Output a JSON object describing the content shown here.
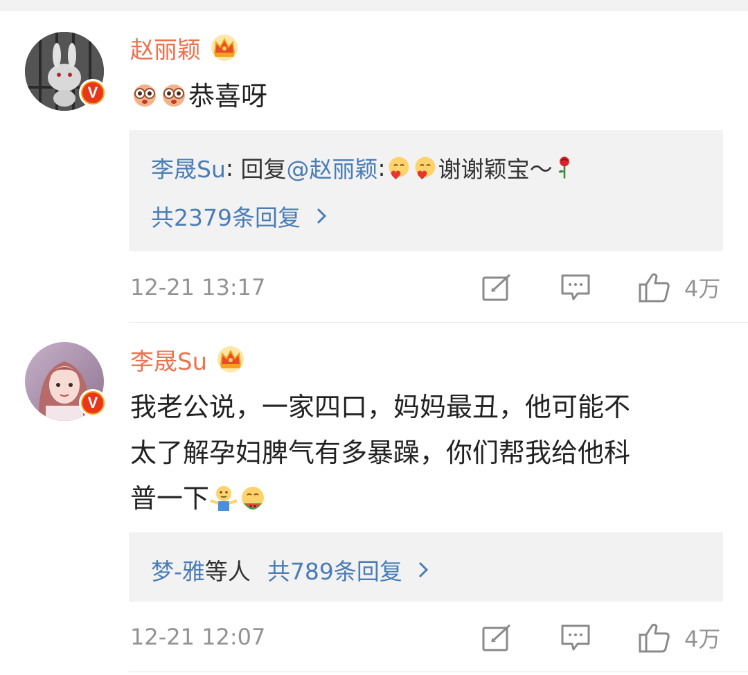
{
  "comments": [
    {
      "author": "赵丽颖",
      "avatar": "snowball-rabbit-avatar",
      "verified": "v-badge",
      "text": "恭喜呀",
      "text_emoji": [
        "surprised-face-emoji",
        "surprised-face-emoji"
      ],
      "reply": {
        "author": "李晟Su",
        "colon": ":",
        "reply_word": " 回复",
        "mention": "@赵丽颖",
        "mention_colon": ":",
        "text": "谢谢颖宝～",
        "count_text": "共2379条回复"
      },
      "time": "12-21 13:17",
      "likes": "4万"
    },
    {
      "author": "李晟Su",
      "avatar": "woman-avatar",
      "verified": "v-badge",
      "text_lines": [
        "我老公说，一家四口，妈妈最丑，他可能不",
        "太了解孕妇脾气有多暴躁，你们帮我给他科",
        "普一下"
      ],
      "reply": {
        "first_name": "梦-雅",
        "others": "等人",
        "count_text": "共789条回复"
      },
      "time": "12-21 12:07",
      "likes": "4万"
    }
  ],
  "colors": {
    "name": "#eb7350",
    "link": "#4a7cb5",
    "meta": "#939393",
    "reply_bg": "#f2f2f2"
  }
}
